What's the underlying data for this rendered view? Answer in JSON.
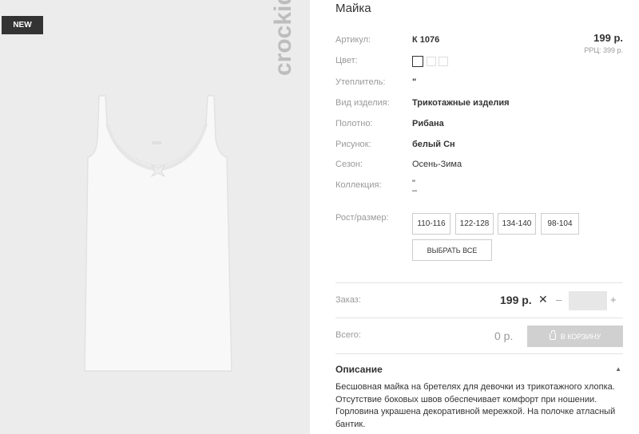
{
  "gallery": {
    "badge": "NEW",
    "brand_logo": "crockid"
  },
  "product": {
    "title": "Майка",
    "price": "199 р.",
    "rrc": "РРЦ: 399 р."
  },
  "attributes": {
    "article": {
      "label": "Артикул:",
      "value": "К 1076"
    },
    "color": {
      "label": "Цвет:"
    },
    "insulation": {
      "label": "Утеплитель:",
      "value": "\""
    },
    "type": {
      "label": "Вид изделия:",
      "value": "Трикотажные изделия"
    },
    "fabric": {
      "label": "Полотно:",
      "value": "Рибана"
    },
    "pattern": {
      "label": "Рисунок:",
      "value": "белый Сн"
    },
    "season": {
      "label": "Сезон:",
      "value": "Осень-Зима"
    },
    "collection": {
      "label": "Коллекция:",
      "value": "\"",
      "value2": "–"
    },
    "size": {
      "label": "Рост/размер:"
    }
  },
  "sizes": [
    "110-116",
    "122-128",
    "134-140",
    "98-104"
  ],
  "select_all": "ВЫБРАТЬ ВСЕ",
  "order": {
    "label": "Заказ:",
    "price": "199 р.",
    "times": "✕",
    "minus": "–",
    "plus": "+",
    "quantity": ""
  },
  "total": {
    "label": "Всего:",
    "value": "0 р.",
    "cart_button": "В КОРЗИНУ"
  },
  "description": {
    "title": "Описание",
    "text": "Бесшовная майка на бретелях для девочки из трикотажного хлопка. Отсутствие боковых швов обеспечивает комфорт при ношении. Горловина украшена декоративной мережкой. На полочке атласный бантик."
  },
  "colors": {
    "gallery_bg": "#ececec",
    "badge_bg": "#333333",
    "cart_button_bg": "#d0d0d0"
  }
}
